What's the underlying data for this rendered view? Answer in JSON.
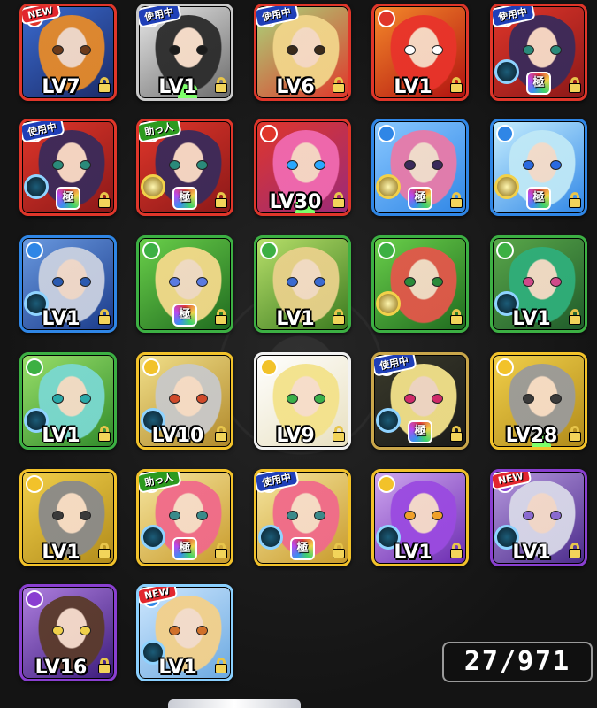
{
  "colors": {
    "fire": "#e0362a",
    "water": "#2f86e6",
    "wood": "#3cb043",
    "light": "#f2c22a",
    "dark": "#8a3fd1"
  },
  "counter": {
    "text": "27/971"
  },
  "cards": [
    {
      "lv": "LV7",
      "badge": "NEW",
      "element": "fire",
      "frame": "#e0362a",
      "c1": "#3a6bd0",
      "c2": "#1b2a66",
      "hair": "#e58a2a",
      "eye": "#6b3a1a"
    },
    {
      "lv": "LV1",
      "badge": "使用中",
      "element": "dark",
      "frame": "#c9c9c9",
      "c1": "#e8e8e8",
      "c2": "#6a6a6a",
      "hair": "#2b2b2b",
      "eye": "#1a1a1a",
      "clover": true
    },
    {
      "lv": "LV6",
      "badge": "使用中",
      "element": "fire",
      "frame": "#e0362a",
      "c1": "#a9d77b",
      "c2": "#e0362a",
      "hair": "#f1d58a",
      "eye": "#3a2a1a"
    },
    {
      "lv": "LV1",
      "badge": "",
      "element": "fire",
      "frame": "#e0362a",
      "c1": "#f58a2a",
      "c2": "#b01010",
      "hair": "#e8332a",
      "eye": "#ffffff"
    },
    {
      "lv": "",
      "badge": "使用中",
      "element": "fire",
      "frame": "#e0362a",
      "c1": "#e0362a",
      "c2": "#8a1818",
      "hair": "#3a2a5a",
      "eye": "#2a8a7a",
      "orb": "blue",
      "kiwami": true
    },
    {
      "lv": "",
      "badge": "使用中",
      "element": "fire",
      "frame": "#e0362a",
      "c1": "#e0362a",
      "c2": "#8a1818",
      "hair": "#3a2a5a",
      "eye": "#2a8a7a",
      "orb": "blue",
      "kiwami": true
    },
    {
      "lv": "",
      "badge": "助っ人",
      "element": "fire",
      "frame": "#e0362a",
      "c1": "#e0362a",
      "c2": "#8a1818",
      "hair": "#3a2a5a",
      "eye": "#2a8a7a",
      "orb": "gold",
      "kiwami": true
    },
    {
      "lv": "LV30",
      "badge": "",
      "element": "fire",
      "frame": "#e0362a",
      "c1": "#e0362a",
      "c2": "#9a2a7a",
      "hair": "#f06ab0",
      "eye": "#2aa8ff",
      "clover": true
    },
    {
      "lv": "",
      "badge": "",
      "element": "water",
      "frame": "#2f86e6",
      "c1": "#8ac8ff",
      "c2": "#2f86e6",
      "hair": "#e87aa8",
      "eye": "#3a2a5a",
      "orb": "gold",
      "kiwami": true
    },
    {
      "lv": "",
      "badge": "",
      "element": "water",
      "frame": "#2f86e6",
      "c1": "#c8f0ff",
      "c2": "#2f86e6",
      "hair": "#bfe8f6",
      "eye": "#2a6ae0",
      "orb": "gold",
      "kiwami": true
    },
    {
      "lv": "LV1",
      "badge": "",
      "element": "water",
      "frame": "#2f86e6",
      "c1": "#6a9ae0",
      "c2": "#1a3a8a",
      "hair": "#c9d0e0",
      "eye": "#2a5ab0",
      "orb": "blue"
    },
    {
      "lv": "",
      "badge": "",
      "element": "wood",
      "frame": "#3cb043",
      "c1": "#6ad04a",
      "c2": "#1f6a1f",
      "hair": "#f3d98a",
      "eye": "#5a7ae0",
      "kiwami": true
    },
    {
      "lv": "LV1",
      "badge": "",
      "element": "wood",
      "frame": "#3cb043",
      "c1": "#b8e06a",
      "c2": "#3a7a1f",
      "hair": "#e8d08a",
      "eye": "#3a6ad0"
    },
    {
      "lv": "",
      "badge": "",
      "element": "wood",
      "frame": "#3cb043",
      "c1": "#6ad04a",
      "c2": "#1f6a1f",
      "hair": "#e2574a",
      "eye": "#2a8a3a",
      "orb": "gold"
    },
    {
      "lv": "LV1",
      "badge": "",
      "element": "wood",
      "frame": "#3cb043",
      "c1": "#5aa84a",
      "c2": "#1f5a2a",
      "hair": "#2fae7a",
      "eye": "#d04a8a",
      "orb": "blue"
    },
    {
      "lv": "LV1",
      "badge": "",
      "element": "wood",
      "frame": "#3cb043",
      "c1": "#9ae06a",
      "c2": "#2f8a2a",
      "hair": "#7ad8d0",
      "eye": "#2aa8a8",
      "orb": "blue"
    },
    {
      "lv": "LV10",
      "badge": "",
      "element": "light",
      "frame": "#f2c22a",
      "c1": "#f2e08a",
      "c2": "#b0882a",
      "hair": "#c8c8c8",
      "eye": "#d04a2a",
      "orb": "blue"
    },
    {
      "lv": "LV9",
      "badge": "",
      "element": "light",
      "frame": "#f2f2f2",
      "c1": "#ffffff",
      "c2": "#e8e0c0",
      "hair": "#f3e28a",
      "eye": "#3ab04a"
    },
    {
      "lv": "",
      "badge": "使用中",
      "element": "light",
      "frame": "#c9a64a",
      "c1": "#3a3a2a",
      "c2": "#1a1a1a",
      "hair": "#f3e28a",
      "eye": "#d02a6a",
      "orb": "blue",
      "kiwami": true
    },
    {
      "lv": "LV28",
      "badge": "",
      "element": "light",
      "frame": "#f2c22a",
      "c1": "#f2d04a",
      "c2": "#b08a1a",
      "hair": "#9a9a9a",
      "eye": "#3a3a3a",
      "clover": true
    },
    {
      "lv": "LV1",
      "badge": "",
      "element": "light",
      "frame": "#f2c22a",
      "c1": "#f2d04a",
      "c2": "#b08a1a",
      "hair": "#8a8a8a",
      "eye": "#3a3a3a"
    },
    {
      "lv": "",
      "badge": "助っ人",
      "element": "light",
      "frame": "#f2c22a",
      "c1": "#f6e6a0",
      "c2": "#c89a2a",
      "hair": "#f06a8a",
      "eye": "#3a8a8a",
      "orb": "blue",
      "kiwami": true
    },
    {
      "lv": "",
      "badge": "使用中",
      "element": "light",
      "frame": "#f2c22a",
      "c1": "#f6e6a0",
      "c2": "#c89a2a",
      "hair": "#f06a8a",
      "eye": "#3a8a8a",
      "orb": "blue",
      "kiwami": true
    },
    {
      "lv": "LV1",
      "badge": "",
      "element": "light",
      "frame": "#f2c22a",
      "c1": "#d0a8f0",
      "c2": "#6a2ab0",
      "hair": "#9a4ae0",
      "eye": "#f0a02a",
      "orb": "blue"
    },
    {
      "lv": "LV1",
      "badge": "NEW",
      "element": "dark",
      "frame": "#8a3fd1",
      "c1": "#b89ae0",
      "c2": "#4a2a8a",
      "hair": "#d8d8e8",
      "eye": "#8a6ad0",
      "orb": "blue"
    },
    {
      "lv": "LV16",
      "badge": "",
      "element": "dark",
      "frame": "#8a3fd1",
      "c1": "#b080e0",
      "c2": "#3a1a7a",
      "hair": "#5a3a2a",
      "eye": "#f0d04a"
    },
    {
      "lv": "LV1",
      "badge": "NEW",
      "element": "water",
      "frame": "#8ad0ff",
      "c1": "#cfe8ff",
      "c2": "#6aa8e0",
      "hair": "#f3d08a",
      "eye": "#d0702a",
      "orb": "blue"
    }
  ]
}
